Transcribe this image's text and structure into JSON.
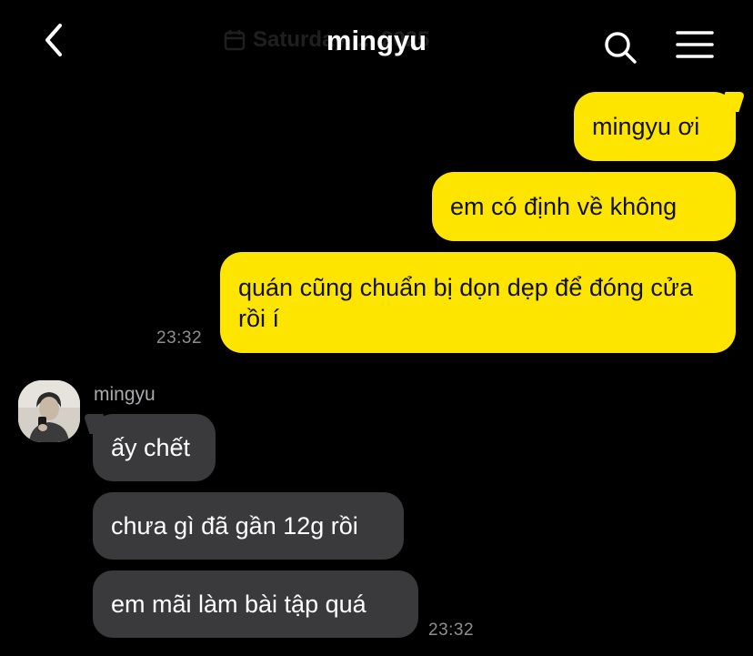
{
  "header": {
    "back_icon": "chevron-left-icon",
    "title": "mingyu",
    "date_ghost": "Saturday, ... 2025",
    "search_icon": "search-icon",
    "menu_icon": "hamburger-menu-icon"
  },
  "colors": {
    "background": "#000000",
    "outgoing_bubble": "#fee500",
    "incoming_bubble": "#3a3a3c",
    "timestamp": "#8e8e93"
  },
  "outgoing": {
    "messages": [
      "mingyu ơi",
      "em có định về không",
      "quán cũng chuẩn bị dọn dẹp để đóng cửa rồi í"
    ],
    "time": "23:32"
  },
  "incoming": {
    "sender": "mingyu",
    "messages": [
      "ấy chết",
      "chưa gì đã gần 12g rồi",
      "em mãi làm bài tập quá"
    ],
    "time": "23:32"
  }
}
